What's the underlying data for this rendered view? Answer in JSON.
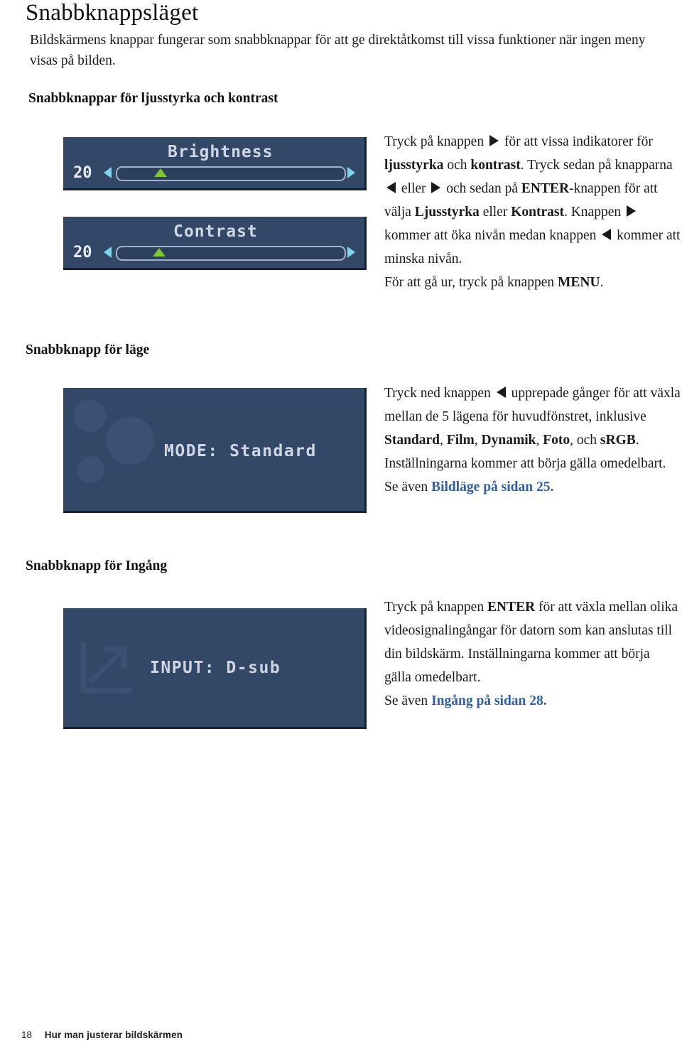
{
  "page": {
    "title": "Snabbknappsläget",
    "intro": "Bildskärmens knappar fungerar som snabbknappar för att ge direktåtkomst till vissa funktioner när ingen meny visas på bilden.",
    "number": "18",
    "footer_text": "Hur man justerar bildskärmen"
  },
  "sections": {
    "brightness_contrast": {
      "heading": "Snabbknappar för ljusstyrka och kontrast",
      "osd": {
        "brightness_label": "Brightness",
        "brightness_value": "20",
        "contrast_label": "Contrast",
        "contrast_value": "20",
        "left_arrow_icon": "triangle-left-icon",
        "right_arrow_icon": "triangle-right-icon",
        "slider_thumb_icon": "triangle-up-marker"
      }
    },
    "mode": {
      "heading": "Snabbknapp för läge",
      "osd": {
        "text": "MODE: Standard"
      },
      "link_text": "Bildläge på sidan 25."
    },
    "input": {
      "heading": "Snabbknapp för Ingång",
      "osd": {
        "text": "INPUT: D-sub",
        "icon": "input-arrow-icon"
      },
      "link_text": "Ingång på sidan 28."
    }
  },
  "colors": {
    "osd_background": "#334766",
    "osd_text": "#cfd6e4",
    "osd_arrow": "#7fd3ef",
    "osd_thumb": "#7ec832",
    "link": "#2f5fa8"
  }
}
